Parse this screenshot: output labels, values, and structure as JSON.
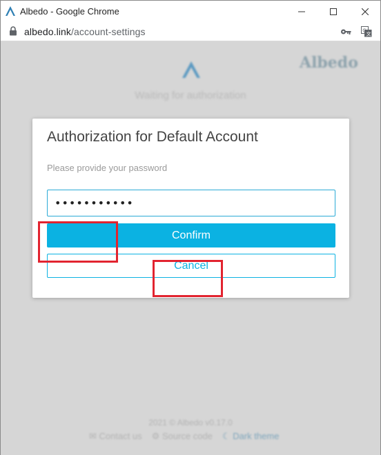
{
  "window": {
    "title": "Albedo - Google Chrome"
  },
  "addressbar": {
    "url_host": "albedo.link",
    "url_path": "/account-settings"
  },
  "background": {
    "brand": "Albedo",
    "waiting_text": "Waiting for authorization",
    "footer_copy": "2021 © Albedo v0.17.0",
    "footer_links": [
      "Contact us",
      "Source code",
      "Dark theme"
    ]
  },
  "dialog": {
    "title": "Authorization for Default Account",
    "hint": "Please provide your password",
    "password_value": "•••••••••••",
    "confirm_label": "Confirm",
    "cancel_label": "Cancel"
  },
  "colors": {
    "accent": "#0bb2e2",
    "annotation": "#e2232f"
  }
}
